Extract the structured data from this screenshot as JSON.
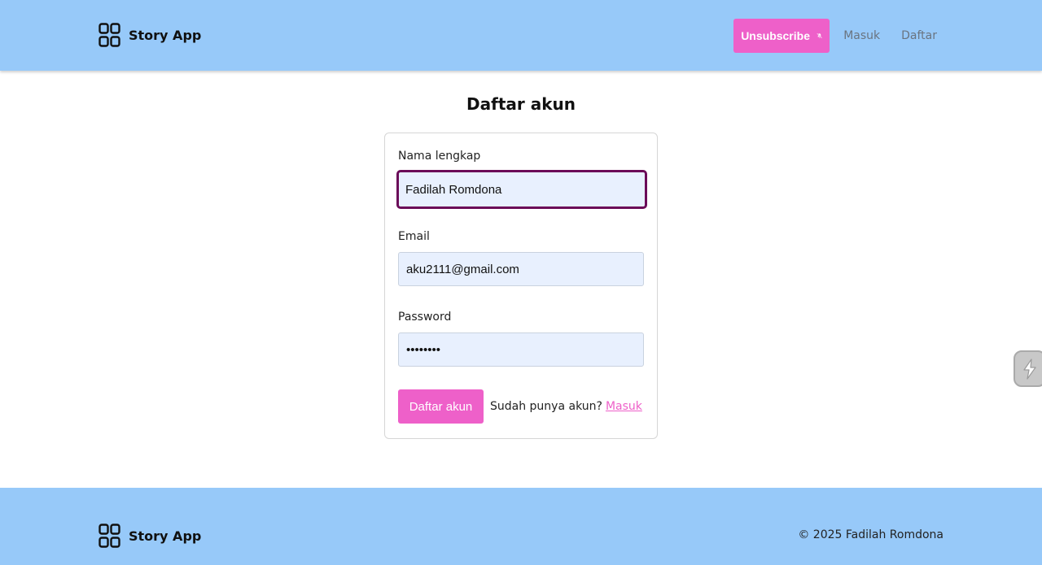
{
  "header": {
    "app_name": "Story App",
    "logo_icon": "grid-four-squares-icon",
    "unsubscribe_label": "Unsubscribe",
    "unsubscribe_icon": "bell-off-icon",
    "nav": {
      "login": "Masuk",
      "register": "Daftar"
    }
  },
  "main": {
    "title": "Daftar akun",
    "form": {
      "name": {
        "label": "Nama lengkap",
        "value": "Fadilah Romdona"
      },
      "email": {
        "label": "Email",
        "value": "aku2111@gmail.com"
      },
      "password": {
        "label": "Password",
        "value": "••••••••"
      },
      "submit_label": "Daftar akun",
      "has_account_text": "Sudah punya akun?",
      "login_link": "Masuk"
    }
  },
  "side_widget": {
    "icon": "extension-widget-icon"
  },
  "footer": {
    "app_name": "Story App",
    "copyright": "© 2025 Fadilah Romdona"
  },
  "colors": {
    "header_bg": "#97c9f9",
    "accent": "#ee60c9",
    "input_bg": "#e8f0fe",
    "focus_border": "#6b0b58"
  }
}
